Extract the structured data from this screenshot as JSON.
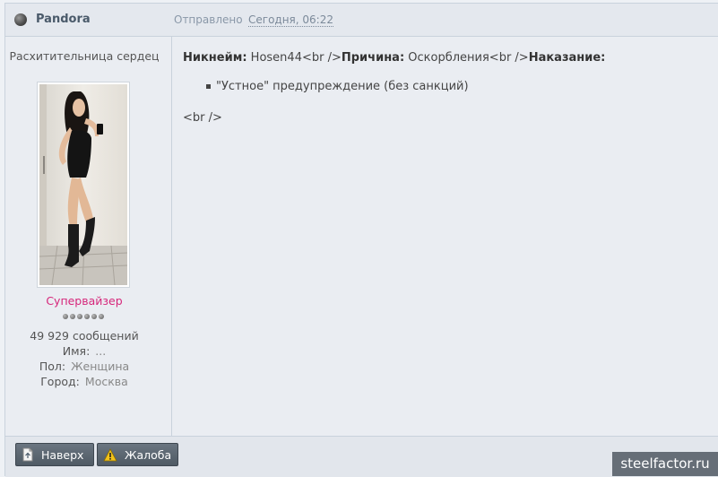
{
  "header": {
    "author": "Pandora",
    "posted_prefix": "Отправлено",
    "posted_date": "Сегодня, 06:22"
  },
  "sidebar": {
    "title": "Расхитительница сердец",
    "group": "Супервайзер",
    "pips_count": 6,
    "posts": "49 929 сообщений",
    "name_label": "Имя:",
    "name_value": "...",
    "gender_label": "Пол:",
    "gender_value": "Женщина",
    "city_label": "Город:",
    "city_value": "Москва"
  },
  "content": {
    "nick_label": "Никнейм:",
    "nick_value": " Hosen44<br />",
    "reason_label": "Причина:",
    "reason_value": " Оскорбления<br />",
    "punishment_label": "Наказание:",
    "bullet": "\"Устное\" предупреждение (без санкций)",
    "trailing": "<br />"
  },
  "footer": {
    "top_button": "Наверх",
    "report_button": "Жалоба"
  },
  "watermark": "steelfactor.ru",
  "colors": {
    "group": "#d6267a",
    "button_bg": "#5a6570"
  }
}
